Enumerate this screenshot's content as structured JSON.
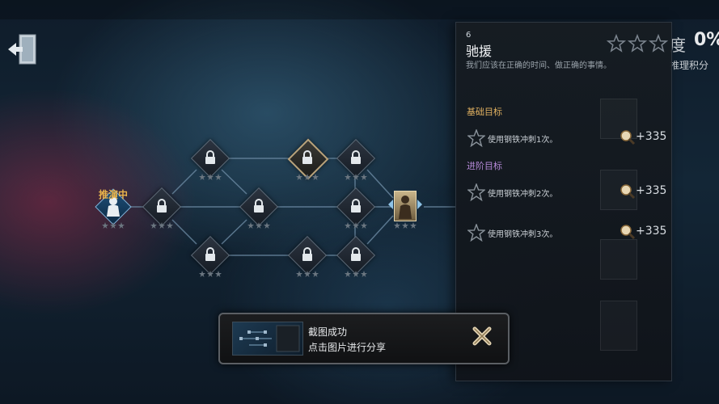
{
  "map": {
    "current_label": "推演中"
  },
  "panel": {
    "number": "6",
    "title": "驰援",
    "subtitle": "我们应该在正确的时间、做正确的事情。",
    "progress_clipped": "度",
    "progress_value": "0%",
    "score_clipped": "推理积分",
    "rating_stars": 0,
    "basic_header": "基础目标",
    "advanced_header": "进阶目标",
    "goals": [
      {
        "text": "使用钢铁冲刺1次。",
        "points": "+335"
      },
      {
        "text": "使用钢铁冲刺2次。",
        "points": "+335"
      },
      {
        "text": "使用钢铁冲刺3次。",
        "points": "+335"
      }
    ]
  },
  "toast": {
    "title": "截图成功",
    "subtitle": "点击图片进行分享"
  },
  "colors": {
    "basic": "#e0b060",
    "advanced": "#b78ad9",
    "current": "#e8b34b"
  }
}
